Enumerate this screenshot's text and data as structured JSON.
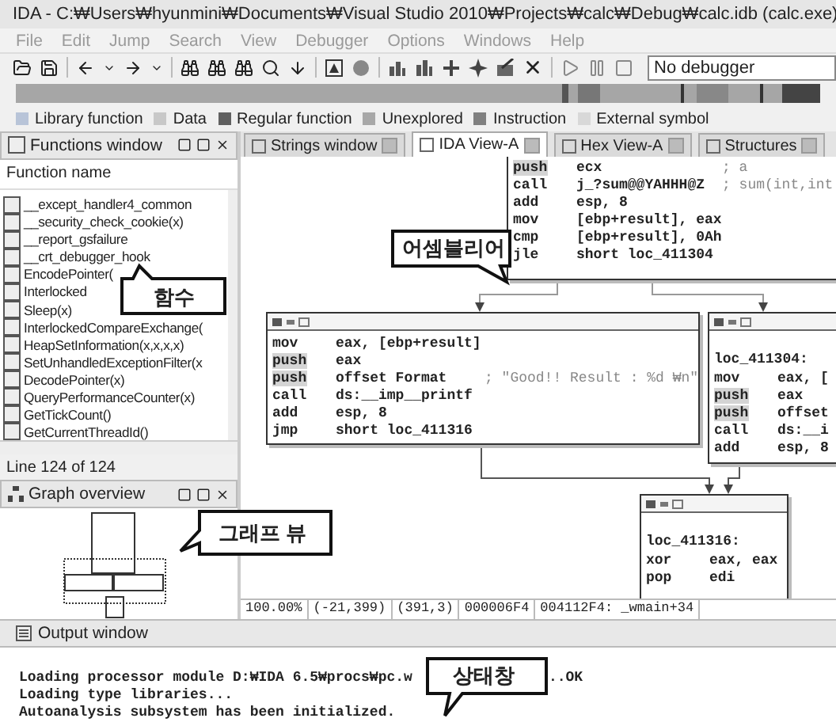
{
  "window": {
    "title": "IDA - C:₩Users₩hyunmini₩Documents₩Visual Studio 2010₩Projects₩calc₩Debug₩calc.idb (calc.exe)"
  },
  "menu": [
    "File",
    "Edit",
    "Jump",
    "Search",
    "View",
    "Debugger",
    "Options",
    "Windows",
    "Help"
  ],
  "debugger_select": {
    "value": "No debugger"
  },
  "legend": [
    {
      "label": "Library function",
      "color": "#b8c4d8"
    },
    {
      "label": "Data",
      "color": "#c8c8c8"
    },
    {
      "label": "Regular function",
      "color": "#606060"
    },
    {
      "label": "Unexplored",
      "color": "#a8a8a8"
    },
    {
      "label": "Instruction",
      "color": "#808080"
    },
    {
      "label": "External symbol",
      "color": "#d8d8d8"
    }
  ],
  "functions_window": {
    "title": "Functions window",
    "column": "Function name",
    "items": [
      "__except_handler4_common",
      "__security_check_cookie(x)",
      "__report_gsfailure",
      "__crt_debugger_hook",
      "EncodePointer(",
      "Interlocked",
      "Sleep(x)",
      "InterlockedCompareExchange(",
      "HeapSetInformation(x,x,x,x)",
      "SetUnhandledExceptionFilter(x",
      "DecodePointer(x)",
      "QueryPerformanceCounter(x)",
      "GetTickCount()",
      "GetCurrentThreadId()"
    ],
    "status": "Line 124 of 124"
  },
  "graph_overview": {
    "title": "Graph overview"
  },
  "tabs": [
    {
      "label": "Strings window",
      "selected": false
    },
    {
      "label": "IDA View-A",
      "selected": true
    },
    {
      "label": "Hex View-A",
      "selected": false
    },
    {
      "label": "Structures",
      "selected": false
    }
  ],
  "graph": {
    "blocks": [
      {
        "lines": [
          {
            "kind": "instr",
            "op": "push",
            "args": "ecx",
            "comment": "; a",
            "highlighted": true
          },
          {
            "kind": "instr",
            "op": "call",
            "args": "j_?sum@@YAHHH@Z",
            "comment": "; sum(int,int",
            "highlighted": false
          },
          {
            "kind": "instr",
            "op": "add",
            "args": "esp, 8",
            "highlighted": false
          },
          {
            "kind": "instr",
            "op": "mov",
            "args": "[ebp+result], eax",
            "highlighted": false
          },
          {
            "kind": "instr",
            "op": "cmp",
            "args": "[ebp+result], 0Ah",
            "highlighted": false
          },
          {
            "kind": "instr",
            "op": "jle",
            "args": "short loc_411304",
            "highlighted": false
          }
        ]
      },
      {
        "lines": [
          {
            "kind": "instr",
            "op": "mov",
            "args": "eax, [ebp+result]",
            "highlighted": false
          },
          {
            "kind": "instr",
            "op": "push",
            "args": "eax",
            "highlighted": true
          },
          {
            "kind": "instr",
            "op": "push",
            "args": "offset Format",
            "comment": "; \"Good!! Result : %d ₩n\"",
            "highlighted": true
          },
          {
            "kind": "instr",
            "op": "call",
            "args": "ds:__imp__printf",
            "highlighted": false
          },
          {
            "kind": "instr",
            "op": "add",
            "args": "esp, 8",
            "highlighted": false
          },
          {
            "kind": "instr",
            "op": "jmp",
            "args": "short loc_411316",
            "highlighted": false
          }
        ]
      },
      {
        "lines": [
          {
            "kind": "label",
            "text": "loc_411304:"
          },
          {
            "kind": "instr",
            "op": "mov",
            "args": "eax, [",
            "highlighted": false
          },
          {
            "kind": "instr",
            "op": "push",
            "args": "eax",
            "highlighted": true
          },
          {
            "kind": "instr",
            "op": "push",
            "args": "offset",
            "highlighted": true
          },
          {
            "kind": "instr",
            "op": "call",
            "args": "ds:__i",
            "highlighted": false
          },
          {
            "kind": "instr",
            "op": "add",
            "args": "esp, 8",
            "highlighted": false
          }
        ]
      },
      {
        "lines": [
          {
            "kind": "label",
            "text": "loc_411316:"
          },
          {
            "kind": "instr",
            "op": "xor",
            "args": "eax, eax",
            "highlighted": false
          },
          {
            "kind": "instr",
            "op": "pop",
            "args": "edi",
            "highlighted": false
          }
        ]
      }
    ],
    "status": [
      "100.00%",
      "(-21,399)",
      "(391,3)",
      "000006F4",
      "004112F4: _wmain+34"
    ]
  },
  "output_window": {
    "title": "Output window",
    "lines": [
      {
        "text": "Loading processor module D:₩IDA 6.5₩procs₩pc.w",
        "rest": "..OK"
      },
      {
        "text": "Loading type libraries..."
      },
      {
        "text": "Autoanalysis subsystem has been initialized."
      }
    ]
  },
  "callouts": [
    "함수",
    "어셈블리어",
    "그래프 뷰",
    "상태창"
  ]
}
